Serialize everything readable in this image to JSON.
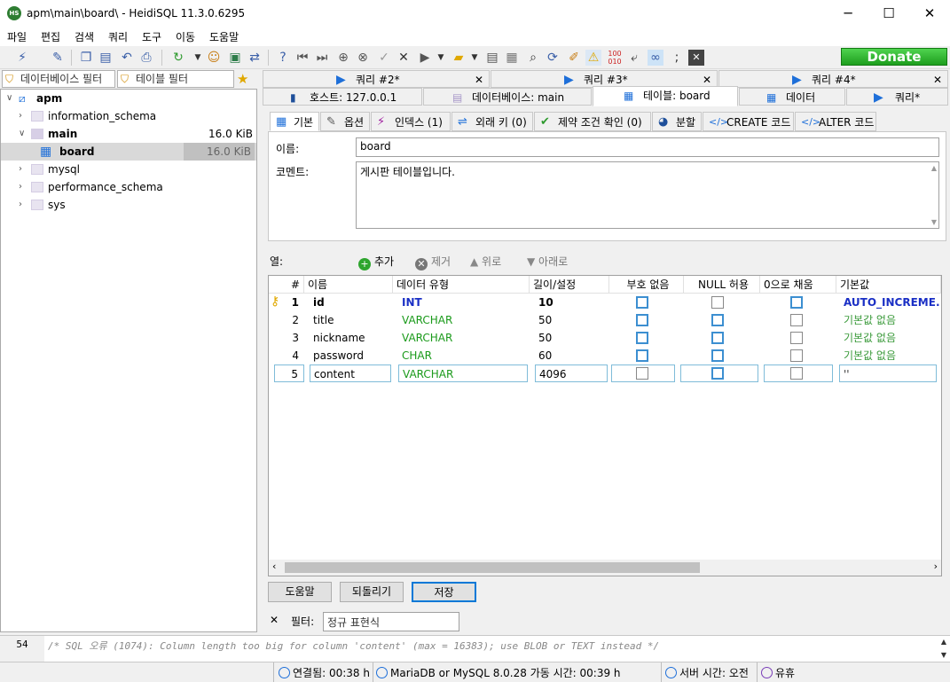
{
  "window": {
    "title": "apm\\main\\board\\ - HeidiSQL 11.3.0.6295",
    "app_badge": "HS",
    "minimize": "─",
    "maximize": "☐",
    "close": "✕"
  },
  "menu": [
    "파일",
    "편집",
    "검색",
    "쿼리",
    "도구",
    "이동",
    "도움말"
  ],
  "toolbar": {
    "donate_label": "Donate"
  },
  "filters": {
    "db_filter_placeholder": "데이터베이스 필터",
    "table_filter_placeholder": "테이블 필터"
  },
  "tree": {
    "server": "apm",
    "databases": [
      {
        "name": "information_schema",
        "size": ""
      },
      {
        "name": "main",
        "size": "16.0 KiB"
      },
      {
        "name": "mysql",
        "size": ""
      },
      {
        "name": "performance_schema",
        "size": ""
      },
      {
        "name": "sys",
        "size": ""
      }
    ],
    "table": {
      "name": "board",
      "size": "16.0 KiB"
    }
  },
  "query_tabs": [
    "쿼리 #2*",
    "쿼리 #3*",
    "쿼리 #4*"
  ],
  "main_tabs": {
    "host": "호스트: 127.0.0.1",
    "database": "데이터베이스: main",
    "table": "테이블: board",
    "data": "데이터",
    "query": "쿼리*"
  },
  "sub_tabs": [
    "기본",
    "옵션",
    "인덱스 (1)",
    "외래 키 (0)",
    "제약 조건 확인 (0)",
    "분할",
    "CREATE 코드",
    "ALTER 코드"
  ],
  "basic": {
    "name_label": "이름:",
    "name_value": "board",
    "comment_label": "코멘트:",
    "comment_value": "게시판 테이블입니다."
  },
  "columns_toolbar": {
    "label": "열:",
    "add": "추가",
    "remove": "제거",
    "up": "위로",
    "down": "아래로"
  },
  "grid": {
    "headers": [
      "#",
      "이름",
      "데이터 유형",
      "길이/설정",
      "부호 없음",
      "NULL 허용",
      "0으로 채움",
      "기본값"
    ],
    "rows": [
      {
        "num": "1",
        "name": "id",
        "type": "INT",
        "length": "10",
        "default": "AUTO_INCREME..."
      },
      {
        "num": "2",
        "name": "title",
        "type": "VARCHAR",
        "length": "50",
        "default": "기본값 없음"
      },
      {
        "num": "3",
        "name": "nickname",
        "type": "VARCHAR",
        "length": "50",
        "default": "기본값 없음"
      },
      {
        "num": "4",
        "name": "password",
        "type": "CHAR",
        "length": "60",
        "default": "기본값 없음"
      },
      {
        "num": "5",
        "name": "content",
        "type": "VARCHAR",
        "length": "4096",
        "default": "''"
      }
    ]
  },
  "buttons": {
    "help": "도움말",
    "revert": "되돌리기",
    "save": "저장"
  },
  "filter_row": {
    "close": "✕",
    "label": "필터:",
    "placeholder": "정규 표현식"
  },
  "log": {
    "line": "54",
    "message": "/* SQL 오류 (1074): Column length too big for column 'content' (max = 16383); use BLOB or TEXT instead */"
  },
  "status": {
    "connected": "연결됨: 00:38 h",
    "server": "MariaDB or MySQL 8.0.28 가동 시간: 00:39 h",
    "server_time": "서버 시간: 오전",
    "idle": "유휴"
  },
  "colors": {
    "accent": "#1e6fd9",
    "donate": "#2eb82e",
    "type_int": "#1a2fc5",
    "type_str": "#1a9a1a"
  }
}
